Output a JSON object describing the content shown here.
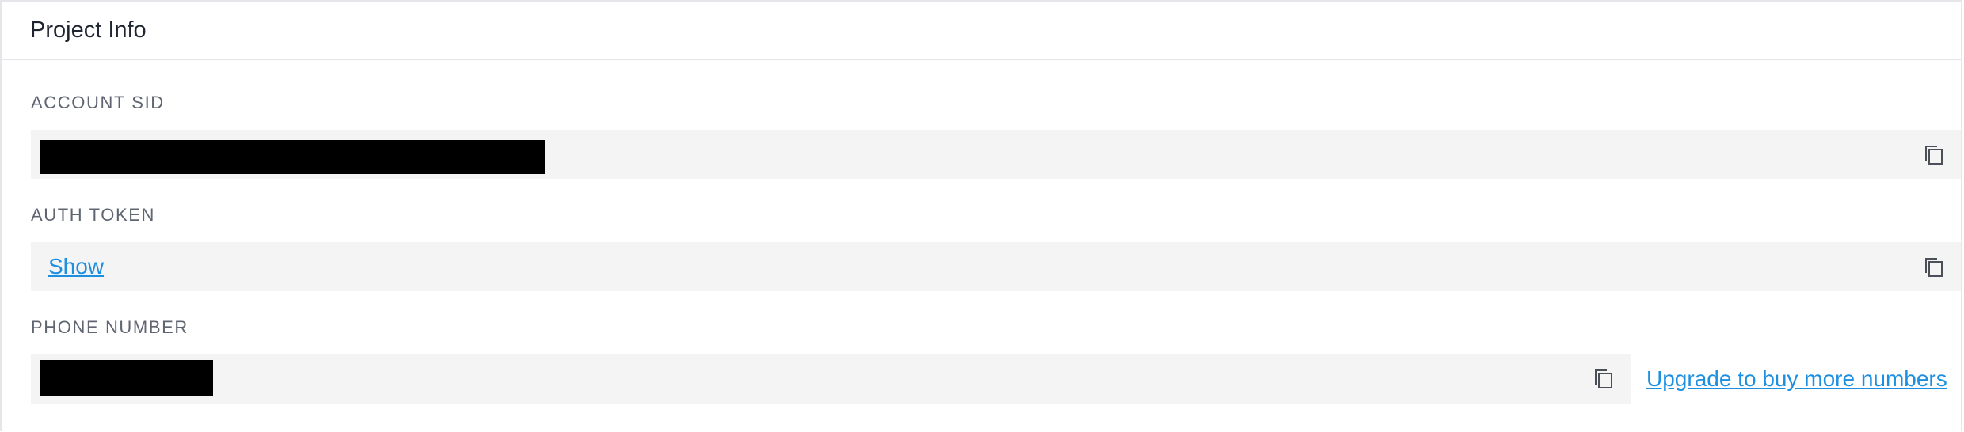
{
  "panel": {
    "title": "Project Info"
  },
  "fields": {
    "account_sid": {
      "label": "ACCOUNT SID"
    },
    "auth_token": {
      "label": "AUTH TOKEN",
      "show_link": "Show"
    },
    "phone_number": {
      "label": "PHONE NUMBER",
      "upgrade_link": "Upgrade to buy more numbers"
    }
  },
  "icons": {
    "copy": "copy-icon"
  },
  "colors": {
    "link": "#1d8fe0",
    "field_background": "#f4f4f5",
    "label_text": "#5f6672",
    "border": "#e4e6ea"
  }
}
